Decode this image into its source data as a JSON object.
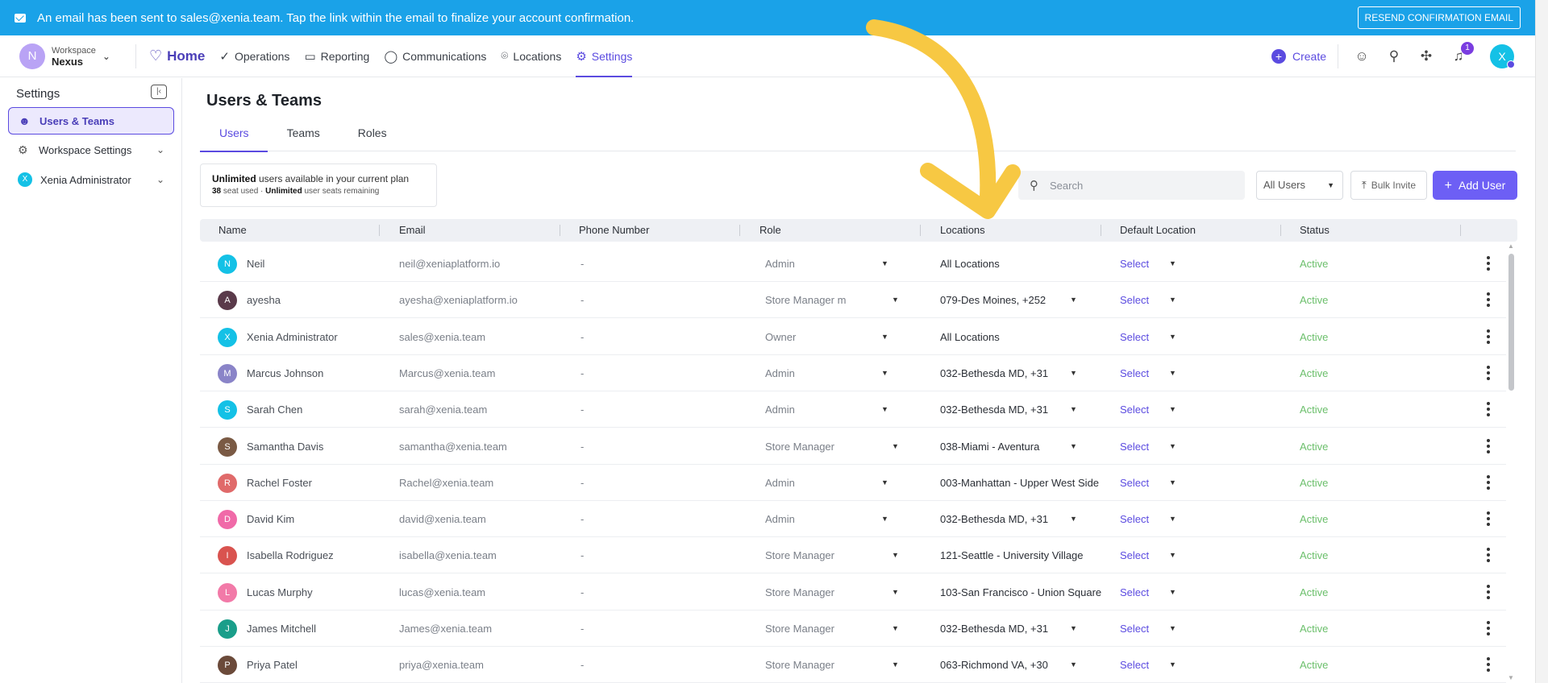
{
  "banner": {
    "message": "An email has been sent to sales@xenia.team. Tap the link within the email to finalize your account confirmation.",
    "resend_label": "RESEND CONFIRMATION EMAIL"
  },
  "workspace": {
    "initial": "N",
    "label": "Workspace",
    "name": "Nexus"
  },
  "nav": {
    "home": "Home",
    "items": [
      "Operations",
      "Reporting",
      "Communications",
      "Locations",
      "Settings"
    ],
    "active": "Settings"
  },
  "toolbar": {
    "create_label": "Create",
    "notifications_count": "1",
    "user_initial": "X"
  },
  "sidebar": {
    "title": "Settings",
    "items": [
      {
        "label": "Users & Teams"
      },
      {
        "label": "Workspace Settings"
      },
      {
        "label": "Xenia Administrator",
        "initial": "X"
      }
    ]
  },
  "page": {
    "title": "Users & Teams",
    "tabs": [
      "Users",
      "Teams",
      "Roles"
    ]
  },
  "plan": {
    "line1_bold": "Unlimited",
    "line1_rest": " users available in your current plan",
    "line2_count": "38",
    "line2_mid": " seat used · ",
    "line2_bold": "Unlimited",
    "line2_rest": " user seats remaining"
  },
  "search": {
    "placeholder": "Search"
  },
  "filter": {
    "selected": "All Users"
  },
  "bulk_label": "Bulk Invite",
  "add_user_label": "Add User",
  "table": {
    "headers": [
      "Name",
      "Email",
      "Phone Number",
      "Role",
      "Locations",
      "Default Location",
      "Status"
    ],
    "rows": [
      {
        "initial": "N",
        "color": "#14c1e6",
        "name": "Neil",
        "email": "neil@xeniaplatform.io",
        "phone": "-",
        "role": "Admin",
        "locations": "All Locations",
        "loc_dropdown": false,
        "default": "Select",
        "status": "Active"
      },
      {
        "initial": "A",
        "color": "#5a3a4a",
        "name": "ayesha",
        "email": "ayesha@xeniaplatform.io",
        "phone": "-",
        "role": "Store Manager m",
        "locations": "079-Des Moines, +252",
        "loc_dropdown": true,
        "default": "Select",
        "status": "Active"
      },
      {
        "initial": "X",
        "color": "#14c1e6",
        "name": "Xenia Administrator",
        "email": "sales@xenia.team",
        "phone": "-",
        "role": "Owner",
        "locations": "All Locations",
        "loc_dropdown": false,
        "default": "Select",
        "status": "Active"
      },
      {
        "initial": "M",
        "color": "#8a84c8",
        "name": "Marcus Johnson",
        "email": "Marcus@xenia.team",
        "phone": "-",
        "role": "Admin",
        "locations": "032-Bethesda MD, +31",
        "loc_dropdown": true,
        "default": "Select",
        "status": "Active"
      },
      {
        "initial": "S",
        "color": "#14c1e6",
        "name": "Sarah Chen",
        "email": "sarah@xenia.team",
        "phone": "-",
        "role": "Admin",
        "locations": "032-Bethesda MD, +31",
        "loc_dropdown": true,
        "default": "Select",
        "status": "Active"
      },
      {
        "initial": "S",
        "color": "#7a5a44",
        "name": "Samantha Davis",
        "email": "samantha@xenia.team",
        "phone": "-",
        "role": "Store Manager",
        "locations": "038-Miami - Aventura",
        "loc_dropdown": true,
        "default": "Select",
        "status": "Active"
      },
      {
        "initial": "R",
        "color": "#e06a6a",
        "name": "Rachel Foster",
        "email": "Rachel@xenia.team",
        "phone": "-",
        "role": "Admin",
        "locations": "003-Manhattan - Upper West Side",
        "loc_dropdown": false,
        "default": "Select",
        "status": "Active"
      },
      {
        "initial": "D",
        "color": "#f06aa8",
        "name": "David Kim",
        "email": "david@xenia.team",
        "phone": "-",
        "role": "Admin",
        "locations": "032-Bethesda MD, +31",
        "loc_dropdown": true,
        "default": "Select",
        "status": "Active"
      },
      {
        "initial": "I",
        "color": "#d9534f",
        "name": "Isabella Rodriguez",
        "email": "isabella@xenia.team",
        "phone": "-",
        "role": "Store Manager",
        "locations": "121-Seattle - University Village",
        "loc_dropdown": false,
        "default": "Select",
        "status": "Active"
      },
      {
        "initial": "L",
        "color": "#f27aa8",
        "name": "Lucas Murphy",
        "email": "lucas@xenia.team",
        "phone": "-",
        "role": "Store Manager",
        "locations": "103-San Francisco - Union Square",
        "loc_dropdown": false,
        "default": "Select",
        "status": "Active"
      },
      {
        "initial": "J",
        "color": "#1a9e8a",
        "name": "James Mitchell",
        "email": "James@xenia.team",
        "phone": "-",
        "role": "Store Manager",
        "locations": "032-Bethesda MD, +31",
        "loc_dropdown": true,
        "default": "Select",
        "status": "Active"
      },
      {
        "initial": "P",
        "color": "#6b4a3a",
        "name": "Priya Patel",
        "email": "priya@xenia.team",
        "phone": "-",
        "role": "Store Manager",
        "locations": "063-Richmond VA, +30",
        "loc_dropdown": true,
        "default": "Select",
        "status": "Active"
      }
    ]
  },
  "colors": {
    "accent": "#5b4be0",
    "banner": "#1aa2e8",
    "status_active": "#6bbf6b",
    "arrow": "#f7c843"
  }
}
